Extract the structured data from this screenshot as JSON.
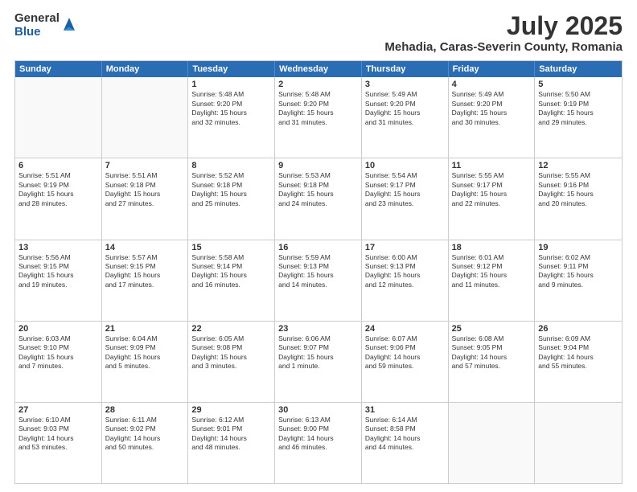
{
  "logo": {
    "general": "General",
    "blue": "Blue"
  },
  "title": "July 2025",
  "location": "Mehadia, Caras-Severin County, Romania",
  "header_days": [
    "Sunday",
    "Monday",
    "Tuesday",
    "Wednesday",
    "Thursday",
    "Friday",
    "Saturday"
  ],
  "weeks": [
    [
      {
        "day": "",
        "content": ""
      },
      {
        "day": "",
        "content": ""
      },
      {
        "day": "1",
        "content": "Sunrise: 5:48 AM\nSunset: 9:20 PM\nDaylight: 15 hours\nand 32 minutes."
      },
      {
        "day": "2",
        "content": "Sunrise: 5:48 AM\nSunset: 9:20 PM\nDaylight: 15 hours\nand 31 minutes."
      },
      {
        "day": "3",
        "content": "Sunrise: 5:49 AM\nSunset: 9:20 PM\nDaylight: 15 hours\nand 31 minutes."
      },
      {
        "day": "4",
        "content": "Sunrise: 5:49 AM\nSunset: 9:20 PM\nDaylight: 15 hours\nand 30 minutes."
      },
      {
        "day": "5",
        "content": "Sunrise: 5:50 AM\nSunset: 9:19 PM\nDaylight: 15 hours\nand 29 minutes."
      }
    ],
    [
      {
        "day": "6",
        "content": "Sunrise: 5:51 AM\nSunset: 9:19 PM\nDaylight: 15 hours\nand 28 minutes."
      },
      {
        "day": "7",
        "content": "Sunrise: 5:51 AM\nSunset: 9:18 PM\nDaylight: 15 hours\nand 27 minutes."
      },
      {
        "day": "8",
        "content": "Sunrise: 5:52 AM\nSunset: 9:18 PM\nDaylight: 15 hours\nand 25 minutes."
      },
      {
        "day": "9",
        "content": "Sunrise: 5:53 AM\nSunset: 9:18 PM\nDaylight: 15 hours\nand 24 minutes."
      },
      {
        "day": "10",
        "content": "Sunrise: 5:54 AM\nSunset: 9:17 PM\nDaylight: 15 hours\nand 23 minutes."
      },
      {
        "day": "11",
        "content": "Sunrise: 5:55 AM\nSunset: 9:17 PM\nDaylight: 15 hours\nand 22 minutes."
      },
      {
        "day": "12",
        "content": "Sunrise: 5:55 AM\nSunset: 9:16 PM\nDaylight: 15 hours\nand 20 minutes."
      }
    ],
    [
      {
        "day": "13",
        "content": "Sunrise: 5:56 AM\nSunset: 9:15 PM\nDaylight: 15 hours\nand 19 minutes."
      },
      {
        "day": "14",
        "content": "Sunrise: 5:57 AM\nSunset: 9:15 PM\nDaylight: 15 hours\nand 17 minutes."
      },
      {
        "day": "15",
        "content": "Sunrise: 5:58 AM\nSunset: 9:14 PM\nDaylight: 15 hours\nand 16 minutes."
      },
      {
        "day": "16",
        "content": "Sunrise: 5:59 AM\nSunset: 9:13 PM\nDaylight: 15 hours\nand 14 minutes."
      },
      {
        "day": "17",
        "content": "Sunrise: 6:00 AM\nSunset: 9:13 PM\nDaylight: 15 hours\nand 12 minutes."
      },
      {
        "day": "18",
        "content": "Sunrise: 6:01 AM\nSunset: 9:12 PM\nDaylight: 15 hours\nand 11 minutes."
      },
      {
        "day": "19",
        "content": "Sunrise: 6:02 AM\nSunset: 9:11 PM\nDaylight: 15 hours\nand 9 minutes."
      }
    ],
    [
      {
        "day": "20",
        "content": "Sunrise: 6:03 AM\nSunset: 9:10 PM\nDaylight: 15 hours\nand 7 minutes."
      },
      {
        "day": "21",
        "content": "Sunrise: 6:04 AM\nSunset: 9:09 PM\nDaylight: 15 hours\nand 5 minutes."
      },
      {
        "day": "22",
        "content": "Sunrise: 6:05 AM\nSunset: 9:08 PM\nDaylight: 15 hours\nand 3 minutes."
      },
      {
        "day": "23",
        "content": "Sunrise: 6:06 AM\nSunset: 9:07 PM\nDaylight: 15 hours\nand 1 minute."
      },
      {
        "day": "24",
        "content": "Sunrise: 6:07 AM\nSunset: 9:06 PM\nDaylight: 14 hours\nand 59 minutes."
      },
      {
        "day": "25",
        "content": "Sunrise: 6:08 AM\nSunset: 9:05 PM\nDaylight: 14 hours\nand 57 minutes."
      },
      {
        "day": "26",
        "content": "Sunrise: 6:09 AM\nSunset: 9:04 PM\nDaylight: 14 hours\nand 55 minutes."
      }
    ],
    [
      {
        "day": "27",
        "content": "Sunrise: 6:10 AM\nSunset: 9:03 PM\nDaylight: 14 hours\nand 53 minutes."
      },
      {
        "day": "28",
        "content": "Sunrise: 6:11 AM\nSunset: 9:02 PM\nDaylight: 14 hours\nand 50 minutes."
      },
      {
        "day": "29",
        "content": "Sunrise: 6:12 AM\nSunset: 9:01 PM\nDaylight: 14 hours\nand 48 minutes."
      },
      {
        "day": "30",
        "content": "Sunrise: 6:13 AM\nSunset: 9:00 PM\nDaylight: 14 hours\nand 46 minutes."
      },
      {
        "day": "31",
        "content": "Sunrise: 6:14 AM\nSunset: 8:58 PM\nDaylight: 14 hours\nand 44 minutes."
      },
      {
        "day": "",
        "content": ""
      },
      {
        "day": "",
        "content": ""
      }
    ]
  ]
}
